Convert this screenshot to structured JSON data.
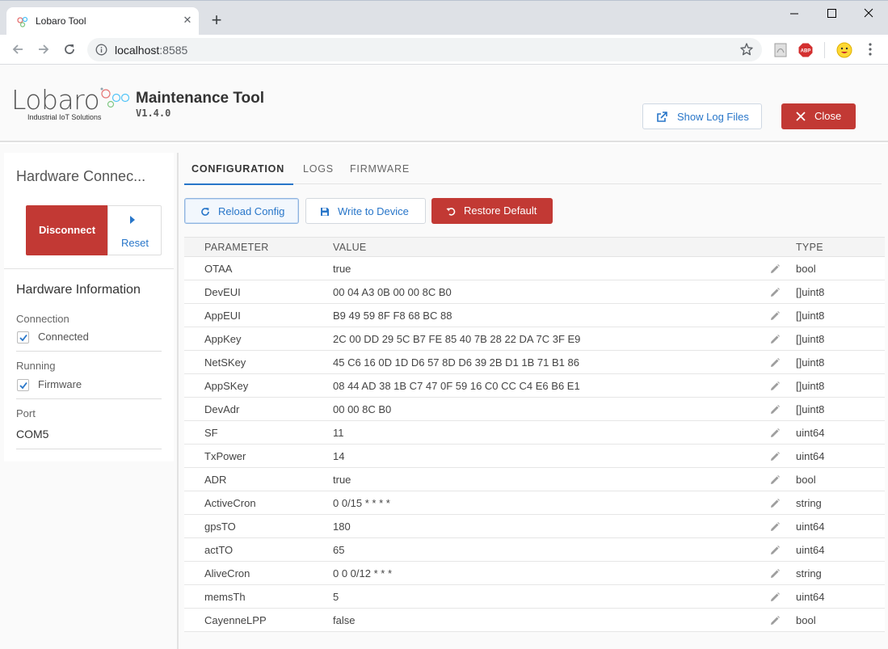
{
  "browser": {
    "tab_title": "Lobaro Tool",
    "tab_close": "✕",
    "new_tab": "+",
    "url_host": "localhost",
    "url_port": ":8585",
    "window_controls": {
      "minimize": "—",
      "maximize": "☐",
      "close": "✕"
    }
  },
  "app": {
    "logo_text": "Lobaro",
    "logo_subtitle": "Industrial IoT Solutions",
    "title": "Maintenance Tool",
    "version": "V1.4.0",
    "show_log_label": "Show Log Files",
    "close_label": "Close"
  },
  "sidebar": {
    "hardware_title": "Hardware Connec...",
    "disconnect_label": "Disconnect",
    "reset_label": "Reset",
    "info_title": "Hardware Information",
    "connection_label": "Connection",
    "connection_value": "Connected",
    "running_label": "Running",
    "running_value": "Firmware",
    "port_label": "Port",
    "port_value": "COM5"
  },
  "tabs": {
    "configuration": "CONFIGURATION",
    "logs": "LOGS",
    "firmware": "FIRMWARE"
  },
  "actions": {
    "reload": "Reload Config",
    "write": "Write to Device",
    "restore": "Restore Default"
  },
  "table": {
    "headers": {
      "parameter": "PARAMETER",
      "value": "VALUE",
      "type": "TYPE"
    },
    "rows": [
      {
        "param": "OTAA",
        "value": "true",
        "type": "bool"
      },
      {
        "param": "DevEUI",
        "value": "00 04 A3 0B 00 00 8C B0",
        "type": "[]uint8"
      },
      {
        "param": "AppEUI",
        "value": "B9 49 59 8F F8 68 BC 88",
        "type": "[]uint8"
      },
      {
        "param": "AppKey",
        "value": "2C 00 DD 29 5C B7 FE 85 40 7B 28 22 DA 7C 3F E9",
        "type": "[]uint8"
      },
      {
        "param": "NetSKey",
        "value": "45 C6 16 0D 1D D6 57 8D D6 39 2B D1 1B 71 B1 86",
        "type": "[]uint8"
      },
      {
        "param": "AppSKey",
        "value": "08 44 AD 38 1B C7 47 0F 59 16 C0 CC C4 E6 B6 E1",
        "type": "[]uint8"
      },
      {
        "param": "DevAdr",
        "value": "00 00 8C B0",
        "type": "[]uint8"
      },
      {
        "param": "SF",
        "value": "11",
        "type": "uint64"
      },
      {
        "param": "TxPower",
        "value": "14",
        "type": "uint64"
      },
      {
        "param": "ADR",
        "value": "true",
        "type": "bool"
      },
      {
        "param": "ActiveCron",
        "value": "0 0/15 * * * *",
        "type": "string"
      },
      {
        "param": "gpsTO",
        "value": "180",
        "type": "uint64"
      },
      {
        "param": "actTO",
        "value": "65",
        "type": "uint64"
      },
      {
        "param": "AliveCron",
        "value": "0 0 0/12 * * *",
        "type": "string"
      },
      {
        "param": "memsTh",
        "value": "5",
        "type": "uint64"
      },
      {
        "param": "CayenneLPP",
        "value": "false",
        "type": "bool"
      }
    ]
  },
  "colors": {
    "accent_blue": "#2876c9",
    "danger_red": "#c23934"
  }
}
